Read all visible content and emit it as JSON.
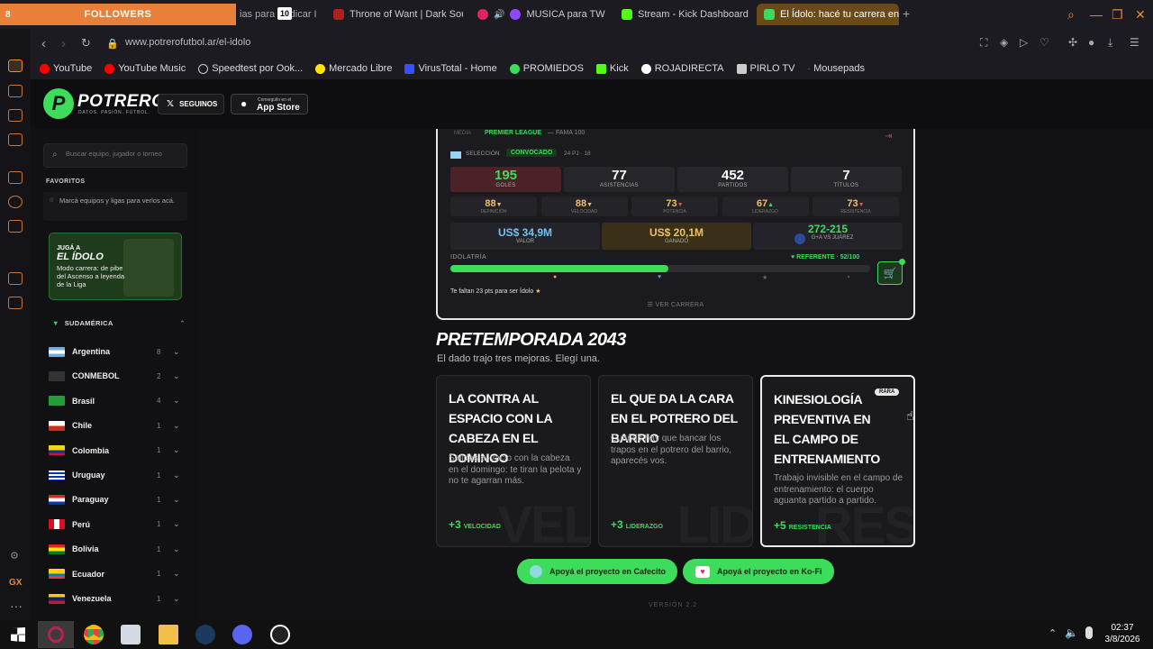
{
  "tabs": {
    "followers": "FOLLOWERS",
    "followers_count": "8",
    "t1": "ias para Pedicar In",
    "t1_badge": "10",
    "t2": "Throne of Want | Dark Soul",
    "t3": "MUSICA para TWIT",
    "t4": "Stream - Kick Dashboard",
    "active": "El Ídolo: hacé tu carrera en"
  },
  "address": {
    "url": "www.potrerofutbol.ar/el-idolo"
  },
  "bookmarks": [
    "YouTube",
    "YouTube Music",
    "Speedtest por Ook...",
    "Mercado Libre",
    "VirusTotal - Home",
    "PROMIEDOS",
    "Kick",
    "ROJADIRECTA",
    "PIRLO TV",
    "Mousepads"
  ],
  "header": {
    "logo": "POTRERO",
    "tagline": "DATOS. PASIÓN. FÚTBOL.",
    "follow": "SEGUINOS",
    "appstore_small": "Conseguilo en el",
    "appstore": "App Store"
  },
  "sidebar": {
    "search_placeholder": "Buscar equipo, jugador o torneo",
    "favorites_title": "FAVORITOS",
    "favorites_hint": "Marcá equipos y ligas para verlos acá.",
    "promo_small": "JUGÁ A",
    "promo_title": "EL ÍDOLO",
    "promo_text": "Modo carrera: de pibe del Ascenso a leyenda de la Liga",
    "region": "SUDAMÉRICA",
    "countries": [
      {
        "name": "Argentina",
        "count": "8"
      },
      {
        "name": "CONMEBOL",
        "count": "2"
      },
      {
        "name": "Brasil",
        "count": "4"
      },
      {
        "name": "Chile",
        "count": "1"
      },
      {
        "name": "Colombia",
        "count": "1"
      },
      {
        "name": "Uruguay",
        "count": "1"
      },
      {
        "name": "Paraguay",
        "count": "1"
      },
      {
        "name": "Perú",
        "count": "1"
      },
      {
        "name": "Bolivia",
        "count": "1"
      },
      {
        "name": "Ecuador",
        "count": "1"
      },
      {
        "name": "Venezuela",
        "count": "1"
      }
    ]
  },
  "card": {
    "media": "MEDIA",
    "league": "PREMIER LEAGUE",
    "fama": "FAMA 100",
    "seleccion": "SELECCIÓN",
    "convocado": "CONVOCADO",
    "pj": "24 PJ · 18",
    "stats": [
      {
        "v": "195",
        "l": "GOLES"
      },
      {
        "v": "77",
        "l": "ASISTENCIAS"
      },
      {
        "v": "452",
        "l": "PARTIDOS"
      },
      {
        "v": "7",
        "l": "TÍTULOS"
      }
    ],
    "attrs": [
      {
        "v": "88",
        "l": "DEFINICIÓN"
      },
      {
        "v": "88",
        "l": "VELOCIDAD"
      },
      {
        "v": "73",
        "l": "POTENCIA"
      },
      {
        "v": "67",
        "l": "LIDERAZGO"
      },
      {
        "v": "73",
        "l": "RESISTENCIA"
      }
    ],
    "valor": "US$ 34,9M",
    "valor_l": "VALOR",
    "ganado": "US$ 20,1M",
    "ganado_l": "GANADO",
    "record": "272-215",
    "record_l": "G+A VS JUÁREZ",
    "idolatria": "IDOLATRÍA",
    "referente": "REFERENTE · 52/100",
    "idolatria_value": 52,
    "faltan": "Te faltan 23 pts para ser Ídolo",
    "ver_carrera": "VER CARRERA"
  },
  "pretemporada": {
    "title": "PRETEMPORADA 2043",
    "subtitle": "El dado trajo tres mejoras. Elegí una.",
    "options": [
      {
        "title": "LA CONTRA AL ESPACIO CON LA CABEZA EN EL DOMINGO",
        "desc": "Salidas al vacío con la cabeza en el domingo: te tiran la pelota y no te agarran más.",
        "bonus": "+3",
        "attr": "VELOCIDAD",
        "wm": "VEL"
      },
      {
        "title": "EL QUE DA LA CARA EN EL POTRERO DEL BARRIO",
        "desc": "Cuando hay que bancar los trapos en el potrero del barrio, aparecés vos.",
        "bonus": "+3",
        "attr": "LIDERAZGO",
        "wm": "LID"
      },
      {
        "title": "KINESIOLOGÍA PREVENTIVA EN EL CAMPO DE ENTRENAMIENTO",
        "desc": "Trabajo invisible en el campo de entrenamiento: el cuerpo aguanta partido a partido.",
        "bonus": "+5",
        "attr": "RESISTENCIA",
        "wm": "RES",
        "tag": "RARA"
      }
    ]
  },
  "footer": {
    "cafecito": "Apoyá el proyecto en Cafecito",
    "kofi": "Apoyá el proyecto en Ko-Fi",
    "version": "VERSIÓN 2.2"
  },
  "taskbar": {
    "time": "02:37",
    "date": "3/8/2026"
  },
  "colors": {
    "accent": "#3ddc5a",
    "gold": "#f0c060",
    "opera": "#e58b3a"
  }
}
